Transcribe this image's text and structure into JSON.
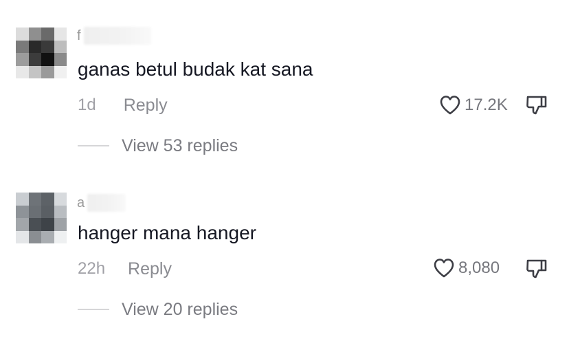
{
  "comments": [
    {
      "username_initial": "f",
      "text": "ganas betul budak kat sana",
      "time": "1d",
      "reply_label": "Reply",
      "likes": "17.2K",
      "view_replies": "View 53 replies"
    },
    {
      "username_initial": "a",
      "text": "hanger mana hanger",
      "time": "22h",
      "reply_label": "Reply",
      "likes": "8,080",
      "view_replies": "View 20 replies"
    }
  ],
  "icons": {
    "like": "heart-outline-icon",
    "dislike": "thumbs-down-outline-icon"
  },
  "colors": {
    "text_primary": "#161823",
    "text_secondary": "#8a8b91",
    "icon": "#3d3e45"
  }
}
